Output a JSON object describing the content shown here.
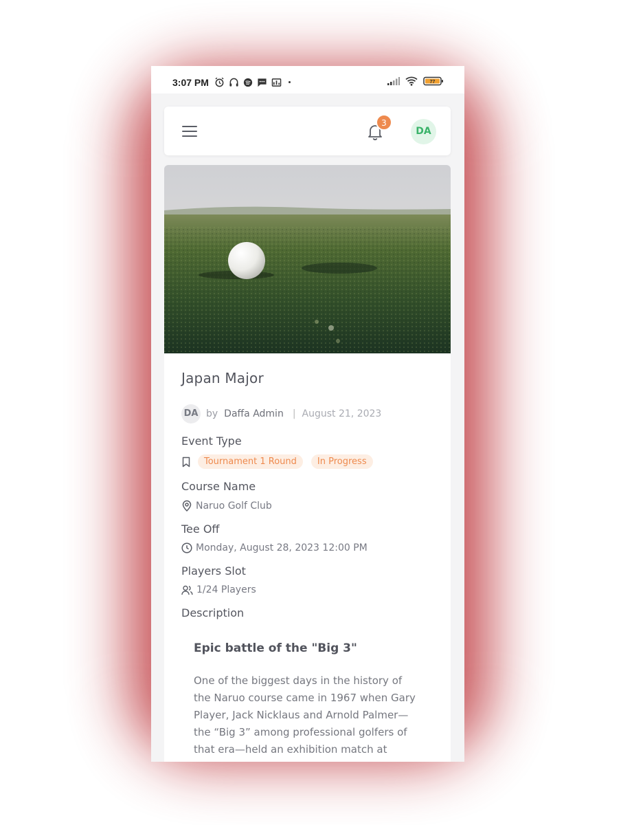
{
  "status_bar": {
    "time": "3:07 PM",
    "battery": "77"
  },
  "header": {
    "notification_count": "3",
    "user_initials": "DA"
  },
  "event": {
    "title": "Japan Major",
    "author_initials": "DA",
    "by_label": "by",
    "author": "Daffa Admin",
    "separator": "|",
    "date": "August 21, 2023",
    "event_type_label": "Event Type",
    "tags": [
      "Tournament 1 Round",
      "In Progress"
    ],
    "course_label": "Course Name",
    "course": "Naruo Golf Club",
    "tee_off_label": "Tee Off",
    "tee_off": "Monday, August 28, 2023 12:00 PM",
    "players_label": "Players Slot",
    "players": "1/24 Players",
    "description_label": "Description",
    "description_heading": "Epic battle of the \"Big 3\"",
    "description_text": "One of the biggest days in the history of the Naruo course came in 1967 when Gary Player, Jack Nicklaus and Arnold Palmer—the “Big 3” among professional golfers of that era—held an exhibition match at"
  },
  "colors": {
    "accent": "#ee8a4e",
    "avatar_green": "#3bb36a",
    "frame_glow": "#c44a4f"
  }
}
